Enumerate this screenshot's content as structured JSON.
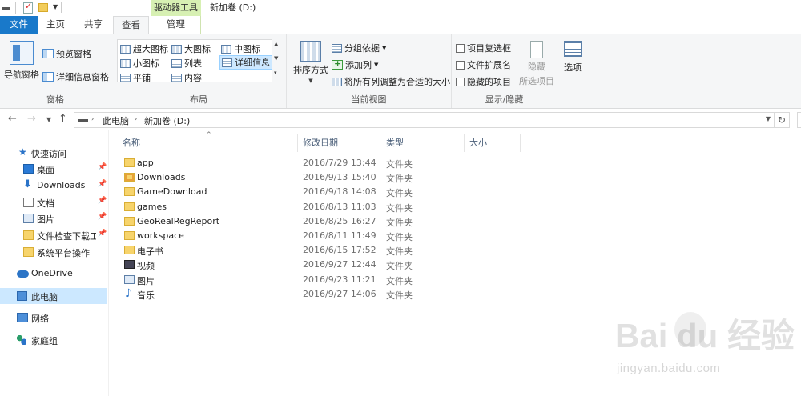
{
  "title_bar": {
    "context_tool": "驱动器工具",
    "window_title": "新加卷 (D:)"
  },
  "tabs": {
    "file": "文件",
    "home": "主页",
    "share": "共享",
    "view": "查看",
    "manage": "管理"
  },
  "ribbon": {
    "panes": {
      "nav_pane": "导航窗格",
      "preview_pane": "预览窗格",
      "details_pane": "详细信息窗格",
      "label": "窗格"
    },
    "layout": {
      "extra_large_icons": "超大图标",
      "large_icons": "大图标",
      "medium_icons": "中图标",
      "small_icons": "小图标",
      "list": "列表",
      "details": "详细信息",
      "tiles": "平铺",
      "content": "内容",
      "label": "布局"
    },
    "current_view": {
      "sort_by": "排序方式",
      "group_by": "分组依据",
      "add_columns": "添加列",
      "size_all_columns": "将所有列调整为合适的大小",
      "label": "当前视图"
    },
    "show_hide": {
      "item_checkboxes": "项目复选框",
      "file_extensions": "文件扩展名",
      "hidden_items": "隐藏的项目",
      "hide_selected": "隐藏",
      "hide_selected_2": "所选项目",
      "label": "显示/隐藏"
    },
    "options": {
      "label": "选项"
    }
  },
  "address": {
    "crumb1": "此电脑",
    "crumb2": "新加卷 (D:)"
  },
  "nav": {
    "quick_access": "快速访问",
    "items": [
      {
        "label": "桌面",
        "pinned": true
      },
      {
        "label": "Downloads",
        "pinned": true
      },
      {
        "label": "文档",
        "pinned": true
      },
      {
        "label": "图片",
        "pinned": true
      },
      {
        "label": "文件检查下载工具",
        "pinned": true
      },
      {
        "label": "系统平台操作",
        "pinned": false
      }
    ],
    "onedrive": "OneDrive",
    "this_pc": "此电脑",
    "network": "网络",
    "homegroup": "家庭组"
  },
  "columns": {
    "name": "名称",
    "date": "修改日期",
    "type": "类型",
    "size": "大小"
  },
  "files": [
    {
      "name": "app",
      "date": "2016/7/29 13:44",
      "type": "文件夹",
      "icon": "folder-icon"
    },
    {
      "name": "Downloads",
      "date": "2016/9/13 15:40",
      "type": "文件夹",
      "icon": "download-folder-icon"
    },
    {
      "name": "GameDownload",
      "date": "2016/9/18 14:08",
      "type": "文件夹",
      "icon": "folder-icon"
    },
    {
      "name": "games",
      "date": "2016/8/13 11:03",
      "type": "文件夹",
      "icon": "folder-icon"
    },
    {
      "name": "GeoRealRegReport",
      "date": "2016/8/25 16:27",
      "type": "文件夹",
      "icon": "folder-icon"
    },
    {
      "name": "workspace",
      "date": "2016/8/11 11:49",
      "type": "文件夹",
      "icon": "folder-icon"
    },
    {
      "name": "电子书",
      "date": "2016/6/15 17:52",
      "type": "文件夹",
      "icon": "folder-icon"
    },
    {
      "name": "视频",
      "date": "2016/9/27 12:44",
      "type": "文件夹",
      "icon": "video-folder-icon"
    },
    {
      "name": "图片",
      "date": "2016/9/23 11:21",
      "type": "文件夹",
      "icon": "picture-folder-icon"
    },
    {
      "name": "音乐",
      "date": "2016/9/27 14:06",
      "type": "文件夹",
      "icon": "music-folder-icon"
    }
  ],
  "watermark": {
    "main": "Bai du 经验",
    "sub": "jingyan.baidu.com"
  }
}
